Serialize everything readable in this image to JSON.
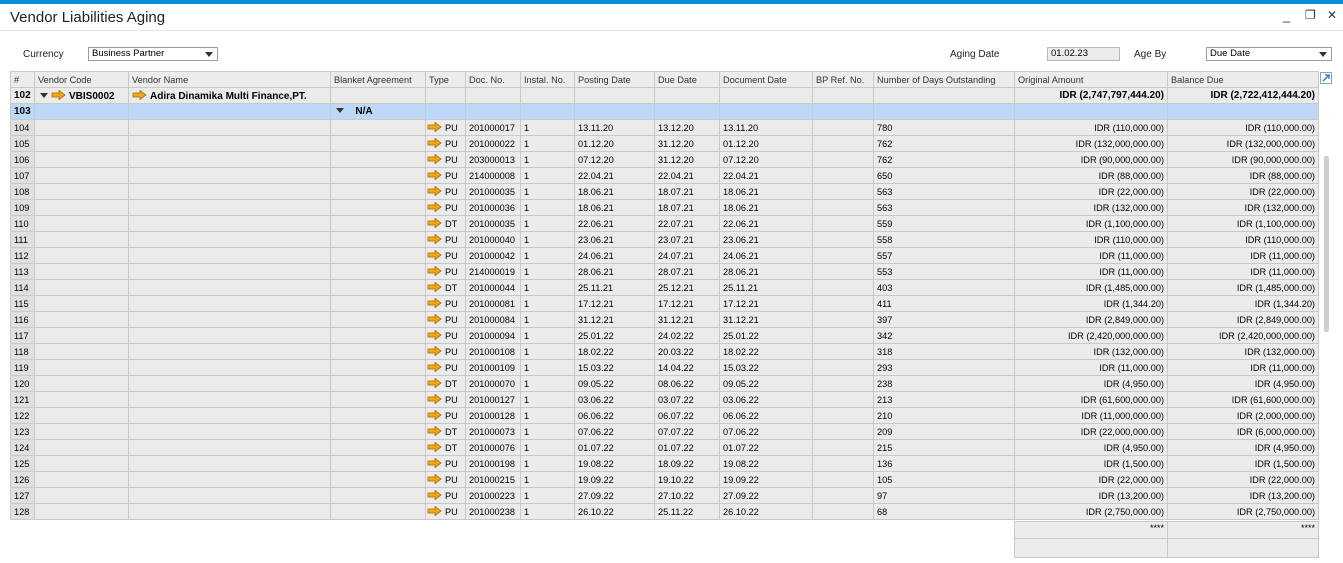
{
  "window": {
    "title": "Vendor Liabilities Aging",
    "minimize": "_",
    "restore": "❐",
    "close": "✕"
  },
  "filters": {
    "currency_label": "Currency",
    "currency_value": "Business Partner",
    "aging_date_label": "Aging Date",
    "aging_date_value": "01.02.23",
    "age_by_label": "Age By",
    "age_by_value": "Due Date"
  },
  "columns": [
    "#",
    "Vendor Code",
    "Vendor Name",
    "Blanket Agreement",
    "Type",
    "Doc. No.",
    "Instal. No.",
    "Posting Date",
    "Due Date",
    "Document Date",
    "BP Ref. No.",
    "Number of Days Outstanding",
    "Original Amount",
    "Balance Due"
  ],
  "vendor_group": {
    "row": "102",
    "code": "VBIS0002",
    "name": "Adira Dinamika Multi Finance,PT.",
    "original_amount": "IDR (2,747,797,444.20)",
    "balance_due": "IDR (2,722,412,444.20)"
  },
  "blanket_group": {
    "row": "103",
    "label": "N/A"
  },
  "rows": [
    [
      "104",
      "PU",
      "201000017",
      "1",
      "13.11.20",
      "13.12.20",
      "13.11.20",
      "780",
      "IDR (110,000.00)",
      "IDR (110,000.00)"
    ],
    [
      "105",
      "PU",
      "201000022",
      "1",
      "01.12.20",
      "31.12.20",
      "01.12.20",
      "762",
      "IDR (132,000,000.00)",
      "IDR (132,000,000.00)"
    ],
    [
      "106",
      "PU",
      "203000013",
      "1",
      "07.12.20",
      "31.12.20",
      "07.12.20",
      "762",
      "IDR (90,000,000.00)",
      "IDR (90,000,000.00)"
    ],
    [
      "107",
      "PU",
      "214000008",
      "1",
      "22.04.21",
      "22.04.21",
      "22.04.21",
      "650",
      "IDR (88,000.00)",
      "IDR (88,000.00)"
    ],
    [
      "108",
      "PU",
      "201000035",
      "1",
      "18.06.21",
      "18.07.21",
      "18.06.21",
      "563",
      "IDR (22,000.00)",
      "IDR (22,000.00)"
    ],
    [
      "109",
      "PU",
      "201000036",
      "1",
      "18.06.21",
      "18.07.21",
      "18.06.21",
      "563",
      "IDR (132,000.00)",
      "IDR (132,000.00)"
    ],
    [
      "110",
      "DT",
      "201000035",
      "1",
      "22.06.21",
      "22.07.21",
      "22.06.21",
      "559",
      "IDR (1,100,000.00)",
      "IDR (1,100,000.00)"
    ],
    [
      "111",
      "PU",
      "201000040",
      "1",
      "23.06.21",
      "23.07.21",
      "23.06.21",
      "558",
      "IDR (110,000.00)",
      "IDR (110,000.00)"
    ],
    [
      "112",
      "PU",
      "201000042",
      "1",
      "24.06.21",
      "24.07.21",
      "24.06.21",
      "557",
      "IDR (11,000.00)",
      "IDR (11,000.00)"
    ],
    [
      "113",
      "PU",
      "214000019",
      "1",
      "28.06.21",
      "28.07.21",
      "28.06.21",
      "553",
      "IDR (11,000.00)",
      "IDR (11,000.00)"
    ],
    [
      "114",
      "DT",
      "201000044",
      "1",
      "25.11.21",
      "25.12.21",
      "25.11.21",
      "403",
      "IDR (1,485,000.00)",
      "IDR (1,485,000.00)"
    ],
    [
      "115",
      "PU",
      "201000081",
      "1",
      "17.12.21",
      "17.12.21",
      "17.12.21",
      "411",
      "IDR (1,344.20)",
      "IDR (1,344.20)"
    ],
    [
      "116",
      "PU",
      "201000084",
      "1",
      "31.12.21",
      "31.12.21",
      "31.12.21",
      "397",
      "IDR (2,849,000.00)",
      "IDR (2,849,000.00)"
    ],
    [
      "117",
      "PU",
      "201000094",
      "1",
      "25.01.22",
      "24.02.22",
      "25.01.22",
      "342",
      "IDR (2,420,000,000.00)",
      "IDR (2,420,000,000.00)"
    ],
    [
      "118",
      "PU",
      "201000108",
      "1",
      "18.02.22",
      "20.03.22",
      "18.02.22",
      "318",
      "IDR (132,000.00)",
      "IDR (132,000.00)"
    ],
    [
      "119",
      "PU",
      "201000109",
      "1",
      "15.03.22",
      "14.04.22",
      "15.03.22",
      "293",
      "IDR (11,000.00)",
      "IDR (11,000.00)"
    ],
    [
      "120",
      "DT",
      "201000070",
      "1",
      "09.05.22",
      "08.06.22",
      "09.05.22",
      "238",
      "IDR (4,950.00)",
      "IDR (4,950.00)"
    ],
    [
      "121",
      "PU",
      "201000127",
      "1",
      "03.06.22",
      "03.07.22",
      "03.06.22",
      "213",
      "IDR (61,600,000.00)",
      "IDR (61,600,000.00)"
    ],
    [
      "122",
      "PU",
      "201000128",
      "1",
      "06.06.22",
      "06.07.22",
      "06.06.22",
      "210",
      "IDR (11,000,000.00)",
      "IDR (2,000,000.00)"
    ],
    [
      "123",
      "DT",
      "201000073",
      "1",
      "07.06.22",
      "07.07.22",
      "07.06.22",
      "209",
      "IDR (22,000,000.00)",
      "IDR (6,000,000.00)"
    ],
    [
      "124",
      "DT",
      "201000076",
      "1",
      "01.07.22",
      "01.07.22",
      "01.07.22",
      "215",
      "IDR (4,950.00)",
      "IDR (4,950.00)"
    ],
    [
      "125",
      "PU",
      "201000198",
      "1",
      "19.08.22",
      "18.09.22",
      "19.08.22",
      "136",
      "IDR (1,500.00)",
      "IDR (1,500.00)"
    ],
    [
      "126",
      "PU",
      "201000215",
      "1",
      "19.09.22",
      "19.10.22",
      "19.09.22",
      "105",
      "IDR (22,000.00)",
      "IDR (22,000.00)"
    ],
    [
      "127",
      "PU",
      "201000223",
      "1",
      "27.09.22",
      "27.10.22",
      "27.09.22",
      "97",
      "IDR (13,200.00)",
      "IDR (13,200.00)"
    ],
    [
      "128",
      "PU",
      "201000238",
      "1",
      "26.10.22",
      "25.11.22",
      "26.10.22",
      "68",
      "IDR (2,750,000.00)",
      "IDR (2,750,000.00)"
    ]
  ],
  "footer": {
    "original_amount": "****",
    "balance_due": "****"
  },
  "colors": {
    "accent": "#0a8fd8",
    "selected_row": "#bcd8f6",
    "link_arrow": "#f0a818"
  }
}
